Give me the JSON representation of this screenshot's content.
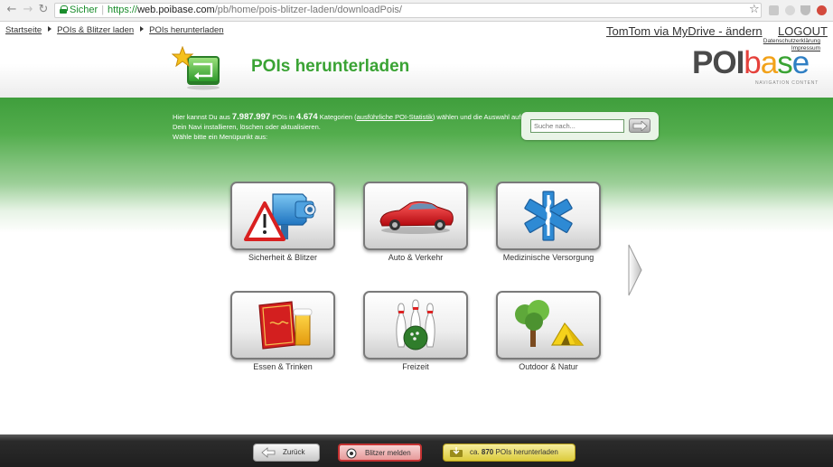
{
  "browser": {
    "secure_label": "Sicher",
    "url_scheme": "https://",
    "url_host": "web.poibase.com",
    "url_path": "/pb/home/pois-blitzer-laden/downloadPois/"
  },
  "breadcrumb": {
    "items": [
      "Startseite",
      "POIs & Blitzer laden",
      "POIs herunterladen"
    ]
  },
  "header": {
    "account_link": "TomTom via MyDrive - ändern",
    "logout_link": "LOGOUT",
    "privacy_link": "Datenschutzerklärung",
    "imprint_link": "Impressum",
    "title": "POIs herunterladen",
    "logo_poi": "POI",
    "logo_base": "base",
    "logo_tagline": "NAVIGATION CONTENT",
    "logo_colors": [
      "#e5413b",
      "#f2a21a",
      "#3aa334",
      "#2f7fc4"
    ]
  },
  "intro": {
    "part1": "Hier kannst Du aus ",
    "poi_count": "7.987.997",
    "part2": " POIs in ",
    "category_count": "4.674",
    "part3": " Kategorien (",
    "stats_link": "ausführliche POI-Statistik",
    "part4": ") wählen und die Auswahl auf Dein Navi installieren, löschen oder aktualisieren.",
    "line2": "Wähle bitte ein Menüpunkt aus:"
  },
  "search": {
    "placeholder": "Suche nach..."
  },
  "categories": [
    {
      "label": "Sicherheit & Blitzer",
      "icon": "speed-camera-warning-icon"
    },
    {
      "label": "Auto & Verkehr",
      "icon": "red-car-icon"
    },
    {
      "label": "Medizinische Versorgung",
      "icon": "star-of-life-icon"
    },
    {
      "label": "Essen & Trinken",
      "icon": "menu-and-beer-icon"
    },
    {
      "label": "Freizeit",
      "icon": "bowling-icon"
    },
    {
      "label": "Outdoor & Natur",
      "icon": "tree-and-tent-icon"
    }
  ],
  "footer": {
    "back_label": "Zurück",
    "blitzer_label": "Blitzer melden",
    "download_prefix": "ca. ",
    "download_count": "870",
    "download_suffix": " POIs herunterladen"
  },
  "colors": {
    "brand_green": "#3aa334",
    "main_green": "#4aa545"
  }
}
